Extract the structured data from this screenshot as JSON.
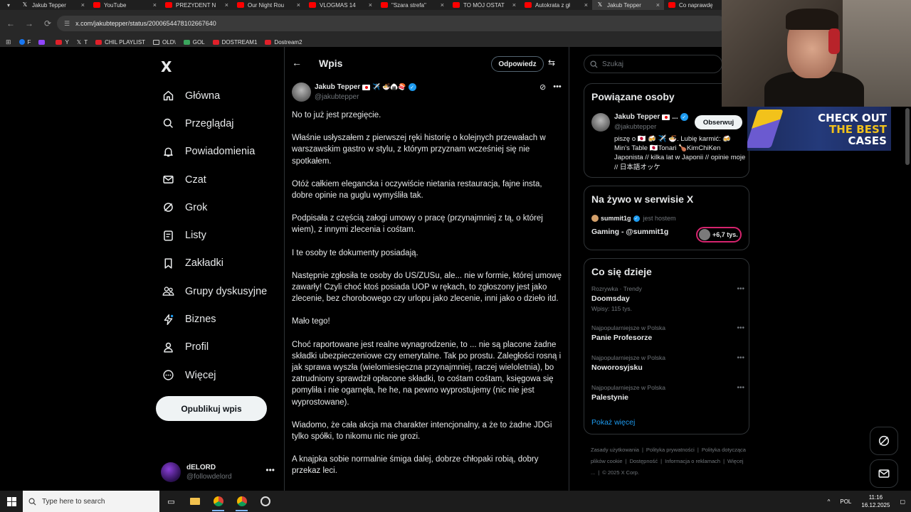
{
  "browser": {
    "tabs": [
      {
        "title": "Jakub Tepper",
        "fav": "x",
        "active": false
      },
      {
        "title": "YouTube",
        "fav": "yt",
        "active": false
      },
      {
        "title": "PREZYDENT N",
        "fav": "yt",
        "active": false
      },
      {
        "title": "Our Night Rou",
        "fav": "yt",
        "active": false
      },
      {
        "title": "VLOGMAS 14",
        "fav": "yt",
        "active": false
      },
      {
        "title": "\"Szara strefa\"",
        "fav": "yt",
        "active": false
      },
      {
        "title": "TO MÓJ OSTAT",
        "fav": "yt",
        "active": false
      },
      {
        "title": "Autokrata z gł",
        "fav": "yt",
        "active": false
      },
      {
        "title": "Jakub Tepper",
        "fav": "x",
        "active": true
      },
      {
        "title": "Co naprawdę",
        "fav": "yt",
        "active": false
      }
    ],
    "url": "x.com/jakubtepper/status/2000654478102667640",
    "bookmarks": [
      {
        "label": "F",
        "type": "fb"
      },
      {
        "label": "",
        "type": "tw"
      },
      {
        "label": "Y",
        "type": "red"
      },
      {
        "label": "T",
        "type": "x"
      },
      {
        "label": "CHIL PLAYLIST",
        "type": "red"
      },
      {
        "label": "OLD\\",
        "type": "fold"
      },
      {
        "label": "GOL",
        "type": "gr"
      },
      {
        "label": "DOSTREAM1",
        "type": "red"
      },
      {
        "label": "Dostream2",
        "type": "red"
      }
    ]
  },
  "nav": {
    "logo": "X",
    "items": [
      {
        "label": "Główna",
        "icon": "home-icon"
      },
      {
        "label": "Przeglądaj",
        "icon": "search-icon"
      },
      {
        "label": "Powiadomienia",
        "icon": "bell-icon"
      },
      {
        "label": "Czat",
        "icon": "mail-icon"
      },
      {
        "label": "Grok",
        "icon": "grok-icon"
      },
      {
        "label": "Listy",
        "icon": "list-icon"
      },
      {
        "label": "Zakładki",
        "icon": "bookmark-icon"
      },
      {
        "label": "Grupy dyskusyjne",
        "icon": "people-icon"
      },
      {
        "label": "Biznes",
        "icon": "lightning-icon"
      },
      {
        "label": "Profil",
        "icon": "person-icon"
      },
      {
        "label": "Więcej",
        "icon": "more-circle-icon"
      }
    ],
    "post_button": "Opublikuj wpis",
    "account": {
      "name": "dELORD",
      "handle": "@followdelord"
    }
  },
  "post": {
    "header_title": "Wpis",
    "reply_button": "Odpowiedz",
    "author_name": "Jakub Tepper",
    "author_emojis": "✈️ 🍜🍙🍣",
    "author_handle": "@jakubtepper",
    "paragraphs": [
      "No to już jest przegięcie.",
      "Właśnie usłyszałem z pierwszej ręki historię o kolejnych przewałach w warszawskim gastro w stylu, z którym przyznam wcześniej się nie spotkałem.",
      "Otóż całkiem elegancka i oczywiście nietania restauracja, fajne insta, dobre opinie na guglu wymyśliła tak.",
      "Podpisała z częścią załogi umowy o pracę (przynajmniej z tą, o której wiem), z innymi zlecenia i cośtam.",
      "I te osoby te dokumenty posiadają.",
      "Następnie zgłosiła te osoby do US/ZUSu, ale... nie w formie, której umowę zawarły! Czyli choć ktoś posiada UOP w rękach, to zgłoszony jest jako zlecenie, bez chorobowego czy urlopu jako zlecenie, inni jako o dzieło itd.",
      "Mało tego!",
      "Choć raportowane jest realne wynagrodzenie, to ... nie są placone żadne składki ubezpieczeniowe czy emerytalne. Tak po prostu. Zaległości rosną i jak sprawa wyszła (wielomiesięczna przynajmniej, raczej wieloletnia), bo zatrudniony sprawdził opłacone składki, to cośtam cośtam, księgowa się pomyliła i nie ogarnęła, he he, na pewno wyprostujemy (nic nie jest wyprostowane).",
      "Wiadomo, że cała akcja ma charakter intencjonalny, a że to żadne JDGi tylko spółki, to nikomu nic nie grozi.",
      "A knajpka sobie normalnie śmiga dalej, dobrze chłopaki robią, dobry przekaz leci."
    ]
  },
  "right": {
    "search_placeholder": "Szukaj",
    "related_title": "Powiązane osoby",
    "related": {
      "name": "Jakub Tepper",
      "name_suffix": "...",
      "handle": "@jakubtepper",
      "follow_label": "Obserwuj",
      "bio": "piszę o 🇯🇵 🍻 ✈️ 🍜. Lubię karmić: 🍻 Min's Table 🇯🇵Tonari 🍗KimChiKen Japonista // kilka lat w Japonii // opinie moje // 日本語オッケ"
    },
    "live_title": "Na żywo w serwisie X",
    "live": {
      "host": "summit1g",
      "host_suffix": "jest hostem",
      "title": "Gaming - @summit1g",
      "count": "+6,7 tys."
    },
    "trends_title": "Co się dzieje",
    "trends": [
      {
        "meta": "Rozrywka · Trendy",
        "name": "Doomsday",
        "sub": "Wpisy: 115 tys."
      },
      {
        "meta": "Najpopularniejsze w Polska",
        "name": "Panie Profesorze",
        "sub": ""
      },
      {
        "meta": "Najpopularniejsze w Polska",
        "name": "Noworosyjsku",
        "sub": ""
      },
      {
        "meta": "Najpopularniejsze w Polska",
        "name": "Palestynie",
        "sub": ""
      }
    ],
    "show_more": "Pokaż więcej",
    "footer": [
      "Zasady użytkowania",
      "|",
      "Polityka prywatności",
      "|",
      "Polityka dotycząca plików cookie",
      "|",
      "Dostępność",
      "|",
      "Informacja o reklamach",
      "|",
      "Więcej ...",
      "|",
      "© 2025 X Corp."
    ]
  },
  "promo": {
    "line1": "CHECK OUT",
    "line2": "THE BEST",
    "line3": "CASES"
  },
  "taskbar": {
    "search_placeholder": "Type here to search",
    "lang": "POL",
    "time": "11:16",
    "date": "16.12.2025"
  }
}
